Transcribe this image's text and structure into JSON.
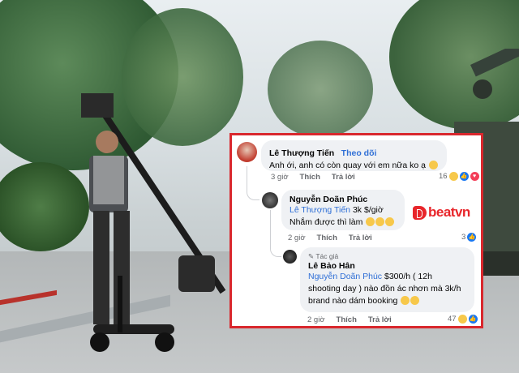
{
  "comments": [
    {
      "author": "Lê Thượng Tiến",
      "follow_label": "Theo dõi",
      "text": "Anh ới, anh có còn quay với em nữa ko ạ",
      "time": "3 giờ",
      "like_label": "Thích",
      "reply_label": "Trả lời",
      "reaction_count": "16"
    },
    {
      "author": "Nguyễn Doãn Phúc",
      "mention": "Lê Thượng Tiến",
      "text_line1": " 3k $/giờ",
      "text_line2": "Nhắm được thì làm",
      "time": "2 giờ",
      "like_label": "Thích",
      "reply_label": "Trả lời",
      "reaction_count": "3"
    },
    {
      "badge": "Tác giả",
      "author": "Lê Bảo Hân",
      "mention": "Nguyễn Doãn Phúc",
      "text_line1": " $300/h ( 12h",
      "text_line2": "shooting day ) nào đồn ác nhơn mà 3k/h",
      "text_line3": "brand nào dám booking",
      "time": "2 giờ",
      "like_label": "Thích",
      "reply_label": "Trả lời",
      "reaction_count": "47"
    }
  ],
  "watermark": "beatvn",
  "colors": {
    "frame": "#d9272d",
    "link": "#2f6fd6",
    "brand": "#e8262b"
  }
}
